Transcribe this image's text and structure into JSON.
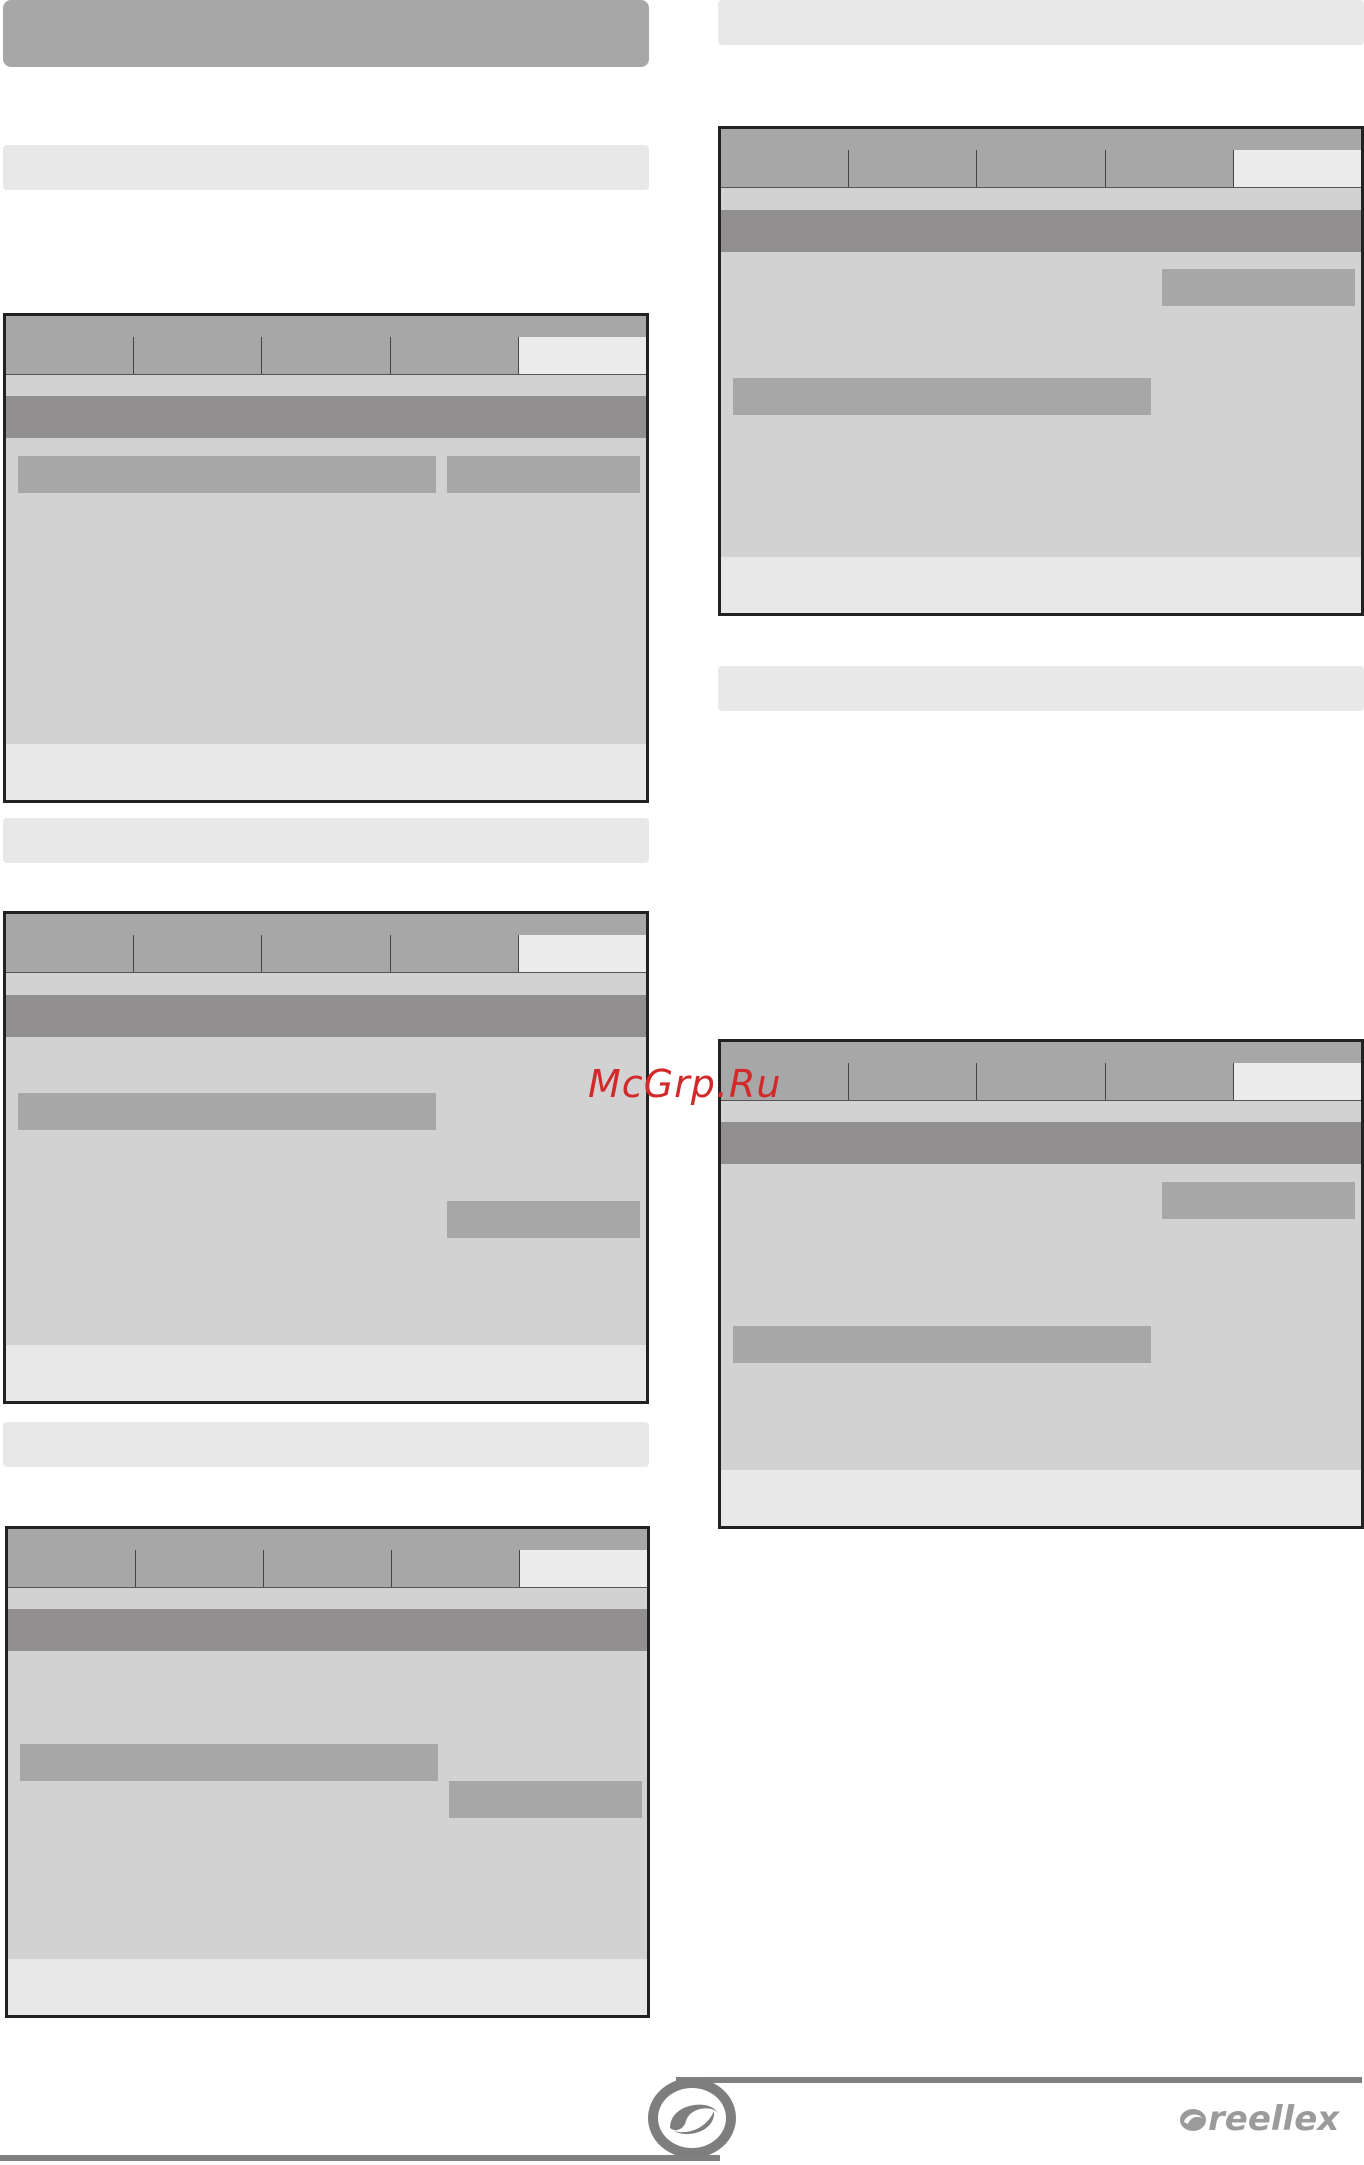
{
  "watermark": "McGrp.Ru",
  "brand": {
    "name": "reellex"
  },
  "screens": [
    {
      "id": "screen-1",
      "active_tab_index": 4,
      "tab_count": 5
    },
    {
      "id": "screen-2",
      "active_tab_index": 4,
      "tab_count": 5
    },
    {
      "id": "screen-3",
      "active_tab_index": 4,
      "tab_count": 5
    },
    {
      "id": "screen-4",
      "active_tab_index": 4,
      "tab_count": 5
    },
    {
      "id": "screen-5",
      "active_tab_index": 4,
      "tab_count": 5
    }
  ],
  "colors": {
    "panel": "#d2d2d2",
    "tab": "#a8a7a8",
    "tab_active": "#ececec",
    "menu_band": "#918f90",
    "section_bar": "#e8e8e8",
    "watermark": "#d22a2a"
  }
}
